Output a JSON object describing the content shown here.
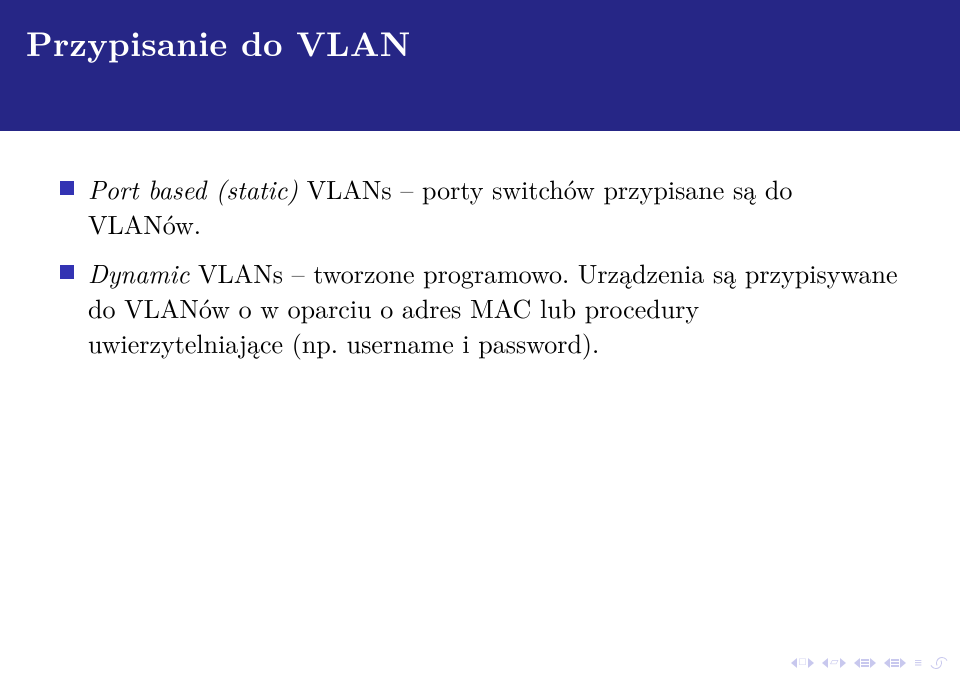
{
  "slide": {
    "title": "Przypisanie do VLAN",
    "bullets": [
      {
        "lead_italic": "Port based (static)",
        "rest": " VLANs – porty switchów przypisane są do VLANów."
      },
      {
        "lead_italic": "Dynamic",
        "rest": " VLANs – tworzone programowo. Urządzenia są przypisywane do VLANów o w oparciu o adres MAC lub procedury uwierzytelniające (np. username i password)."
      }
    ]
  }
}
